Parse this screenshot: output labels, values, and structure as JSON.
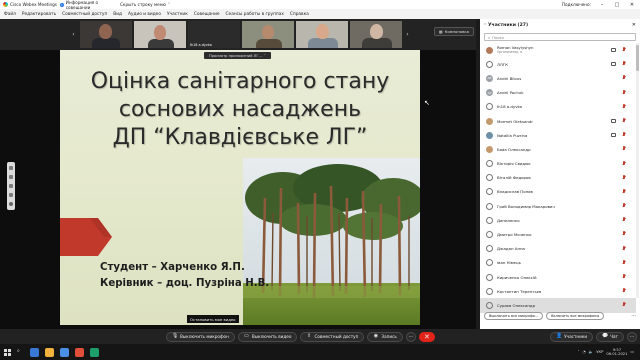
{
  "titlebar": {
    "app": "Cisco Webex Meetings",
    "info": "Информация о совещании",
    "hide": "Скрыть строку меню",
    "host": "Подключено:"
  },
  "menu": [
    "Файл",
    "Редактировать",
    "Совместный доступ",
    "Вид",
    "Аудио и видео",
    "Участник",
    "Совещание",
    "Сеансы работы в группах",
    "Справка"
  ],
  "strip": {
    "tiles": [
      "",
      "",
      "",
      "Ih18 a.dyvko",
      "",
      ""
    ],
    "layout_button": "Компоновка"
  },
  "share": {
    "tab_label": "Просмотр приложений ЛГ...",
    "stop_video": "Остановить мое видео"
  },
  "slide": {
    "title_lines": [
      "Оцінка санітарного стану",
      "соснових насаджень",
      "ДП “Клавдієвське ЛГ”"
    ],
    "student": "Студент – Харченко Я.П.",
    "supervisor": "Керівник – доц. Пузріна Н.В."
  },
  "controls": {
    "mute": "Выключить микрофон",
    "video": "Выключить видео",
    "share": "Совместный доступ",
    "record": "Запись",
    "more": "···",
    "end": "✕",
    "participants": "Участники",
    "chat": "Чат"
  },
  "panel": {
    "title": "Участники (27)",
    "search_placeholder": "Поиск",
    "participants": [
      {
        "name": "Roman Vasylyshyn",
        "sub": "Организатор, я",
        "avatar": "photo1",
        "initials": "",
        "cam": true,
        "mic_on": false
      },
      {
        "name": "ЛЛГК",
        "sub": "",
        "avatar": "icon",
        "initials": "",
        "cam": true,
        "mic_on": false
      },
      {
        "name": "Andrii Bilous",
        "sub": "",
        "avatar": "gray",
        "initials": "AB",
        "cam": false,
        "mic_on": false
      },
      {
        "name": "Andrii Pochuk",
        "sub": "",
        "avatar": "gray",
        "initials": "AP",
        "cam": false,
        "mic_on": false
      },
      {
        "name": "Ih18 a.dyvko",
        "sub": "",
        "avatar": "icon",
        "initials": "",
        "cam": false,
        "mic_on": false
      },
      {
        "name": "Mormet Oleksandr",
        "sub": "",
        "avatar": "photo2",
        "initials": "",
        "cam": true,
        "mic_on": false
      },
      {
        "name": "Nataliia Puzrina",
        "sub": "",
        "avatar": "photo3",
        "initials": "",
        "cam": true,
        "mic_on": false
      },
      {
        "name": "Бааа Олександр",
        "sub": "",
        "avatar": "photo2",
        "initials": "",
        "cam": false,
        "mic_on": false
      },
      {
        "name": "Вікторія Свидюк",
        "sub": "",
        "avatar": "icon",
        "initials": "",
        "cam": false,
        "mic_on": false
      },
      {
        "name": "Віталій Федоров",
        "sub": "",
        "avatar": "icon",
        "initials": "",
        "cam": false,
        "mic_on": false
      },
      {
        "name": "Владислав Попов",
        "sub": "",
        "avatar": "icon",
        "initials": "",
        "cam": false,
        "mic_on": false
      },
      {
        "name": "Гриб Володимир Макарович",
        "sub": "",
        "avatar": "icon",
        "initials": "",
        "cam": false,
        "mic_on": false
      },
      {
        "name": "Даниленко",
        "sub": "",
        "avatar": "icon",
        "initials": "",
        "cam": false,
        "mic_on": false
      },
      {
        "name": "Дмитро Моченко",
        "sub": "",
        "avatar": "icon",
        "initials": "",
        "cam": false,
        "mic_on": false
      },
      {
        "name": "Джадан Анна",
        "sub": "",
        "avatar": "icon",
        "initials": "",
        "cam": false,
        "mic_on": false
      },
      {
        "name": "Іван Німець",
        "sub": "",
        "avatar": "icon",
        "initials": "",
        "cam": false,
        "mic_on": false
      },
      {
        "name": "Кириченко Олексій",
        "sub": "",
        "avatar": "icon",
        "initials": "",
        "cam": false,
        "mic_on": false
      },
      {
        "name": "Костянтин Терентьєв",
        "sub": "",
        "avatar": "icon",
        "initials": "",
        "cam": false,
        "mic_on": false
      },
      {
        "name": "Сураєв Олександр",
        "sub": "",
        "avatar": "icon",
        "initials": "",
        "cam": false,
        "mic_on": false
      }
    ],
    "mute_all": "Выключить все микрофо...",
    "unmute_all": "Включить все микрофоны",
    "more": "···"
  },
  "taskbar": {
    "time": "9:57",
    "date": "06.01.2021",
    "lang": "УКР"
  },
  "colors": {
    "accent_red": "#e2231a",
    "slide_bg": "#e6e9cf"
  }
}
